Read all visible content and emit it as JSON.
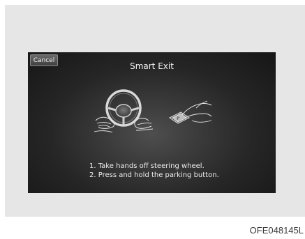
{
  "screen": {
    "cancel_label": "Cancel",
    "title": "Smart Exit",
    "instructions": [
      "1. Take hands off steering wheel.",
      "2. Press and hold the parking button."
    ]
  },
  "figure_code": "OFE048145L",
  "icons": {
    "hands_off_wheel": "steering-wheel-hands-off-icon",
    "parking_button": "parking-button-press-icon"
  }
}
